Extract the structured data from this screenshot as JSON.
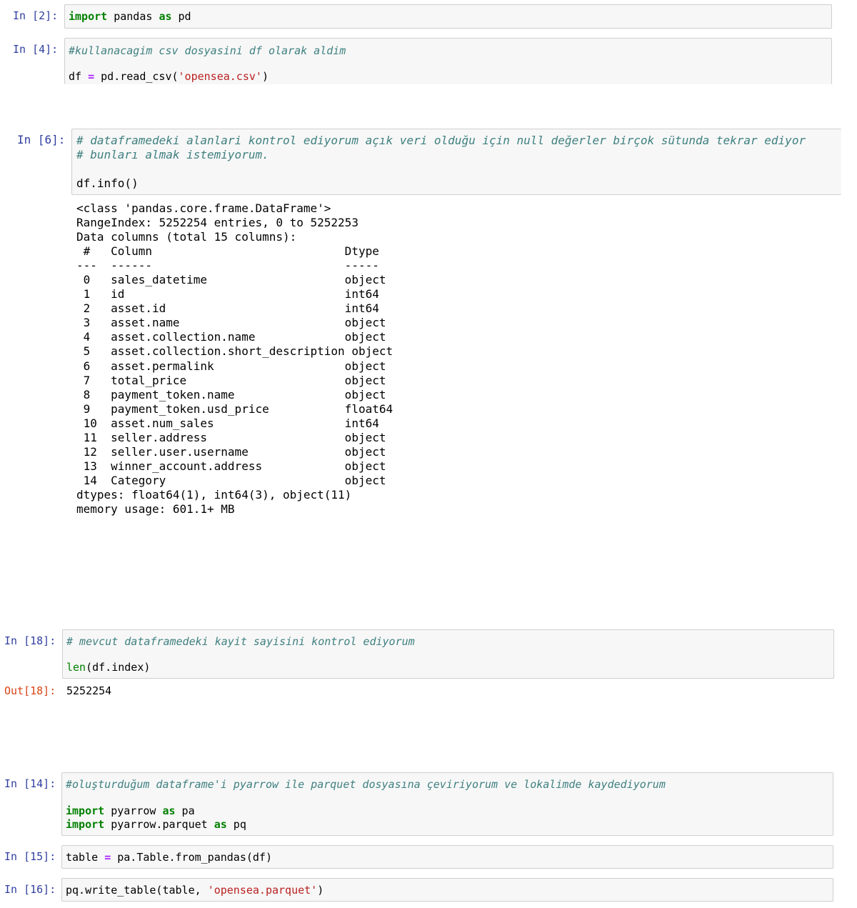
{
  "cells": {
    "c2": {
      "prompt": "In [2]:",
      "kw_import": "import",
      "module": " pandas ",
      "kw_as": "as",
      "alias": " pd"
    },
    "c4": {
      "prompt": "In [4]:",
      "comment": "#kullanacagim csv dosyasini df olarak aldim",
      "code_pre": "df ",
      "op_eq": "=",
      "code_mid": " pd.read_csv(",
      "string": "'opensea.csv'",
      "code_post": ")"
    },
    "c6": {
      "prompt": "In [6]:",
      "comment1": "# dataframedeki alanlari kontrol ediyorum açık veri olduğu için null değerler birçok sütunda tekrar ediyor",
      "comment2": "# bunları almak istemiyorum.",
      "code": "df.info()",
      "output": {
        "lines": [
          "<class 'pandas.core.frame.DataFrame'>",
          "RangeIndex: 5252254 entries, 0 to 5252253",
          "Data columns (total 15 columns):",
          " #   Column                            Dtype  ",
          "---  ------                            -----  ",
          " 0   sales_datetime                    object ",
          " 1   id                                int64  ",
          " 2   asset.id                          int64  ",
          " 3   asset.name                        object ",
          " 4   asset.collection.name             object ",
          " 5   asset.collection.short_description object ",
          " 6   asset.permalink                   object ",
          " 7   total_price                       object ",
          " 8   payment_token.name                object ",
          " 9   payment_token.usd_price           float64",
          " 10  asset.num_sales                   int64  ",
          " 11  seller.address                    object ",
          " 12  seller.user.username              object ",
          " 13  winner_account.address            object ",
          " 14  Category                          object ",
          "dtypes: float64(1), int64(3), object(11)",
          "memory usage: 601.1+ MB"
        ]
      }
    },
    "c18": {
      "prompt": "In [18]:",
      "comment": "# mevcut dataframedeki kayit sayisini kontrol ediyorum",
      "builtin": "len",
      "code": "(df.index)",
      "out_prompt": "Out[18]:",
      "out_value": "5252254"
    },
    "c14": {
      "prompt": "In [14]:",
      "comment": "#oluşturduğum dataframe'i pyarrow ile parquet dosyasına çeviriyorum ve lokalimde kaydediyorum",
      "l1_import": "import",
      "l1_mod": " pyarrow ",
      "l1_as": "as",
      "l1_alias": " pa",
      "l2_import": "import",
      "l2_mod": " pyarrow.parquet ",
      "l2_as": "as",
      "l2_alias": " pq"
    },
    "c15": {
      "prompt": "In [15]:",
      "pre": "table ",
      "op_eq": "=",
      "post": " pa.Table.from_pandas(df)"
    },
    "c16": {
      "prompt": "In [16]:",
      "pre": "pq.write_table(table, ",
      "string": "'opensea.parquet'",
      "post": ")"
    }
  }
}
